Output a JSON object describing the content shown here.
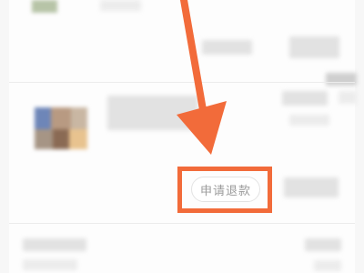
{
  "refund_button": {
    "label": "申请退款"
  },
  "annotation": {
    "color": "#f26b3a",
    "highlight_target": "申请退款"
  },
  "colors": {
    "background": "#ffffff",
    "blur_gray": "#e2e2e2",
    "button_border": "#e3e3e3",
    "button_text": "#9b9b9b"
  }
}
